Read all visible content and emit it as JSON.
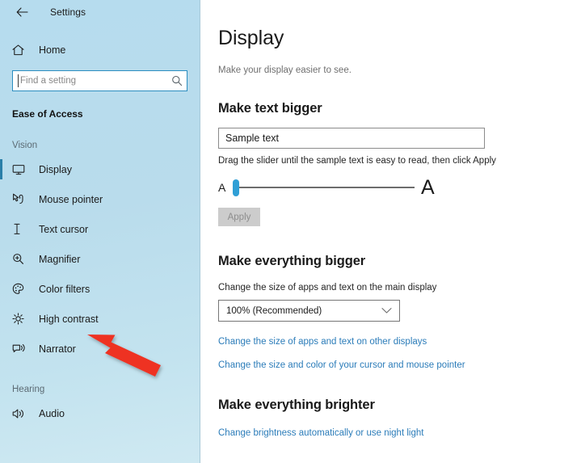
{
  "window": {
    "back_label": "Back",
    "title": "Settings"
  },
  "sidebar": {
    "home": {
      "label": "Home",
      "icon": "home-icon"
    },
    "search": {
      "value": "",
      "placeholder": "Find a setting",
      "icon": "search-icon"
    },
    "category": "Ease of Access",
    "groups": [
      {
        "heading": "Vision",
        "items": [
          {
            "label": "Display",
            "icon": "monitor-icon",
            "selected": true
          },
          {
            "label": "Mouse pointer",
            "icon": "mouse-pointer-icon",
            "selected": false
          },
          {
            "label": "Text cursor",
            "icon": "text-cursor-icon",
            "selected": false
          },
          {
            "label": "Magnifier",
            "icon": "magnifier-icon",
            "selected": false
          },
          {
            "label": "Color filters",
            "icon": "palette-icon",
            "selected": false
          },
          {
            "label": "High contrast",
            "icon": "sun-icon",
            "selected": false
          },
          {
            "label": "Narrator",
            "icon": "narrator-icon",
            "selected": false
          }
        ]
      },
      {
        "heading": "Hearing",
        "items": [
          {
            "label": "Audio",
            "icon": "speaker-icon",
            "selected": false
          }
        ]
      }
    ]
  },
  "main": {
    "title": "Display",
    "subtitle": "Make your display easier to see.",
    "make_text_bigger": {
      "heading": "Make text bigger",
      "sample_text": "Sample text",
      "hint": "Drag the slider until the sample text is easy to read, then click Apply",
      "slider": {
        "min_label": "A",
        "max_label": "A",
        "value": 0,
        "min": 0,
        "max": 100
      },
      "apply_label": "Apply"
    },
    "make_everything_bigger": {
      "heading": "Make everything bigger",
      "scale_label": "Change the size of apps and text on the main display",
      "scale_value": "100% (Recommended)",
      "chevron_icon": "chevron-down-icon",
      "links": [
        "Change the size of apps and text on other displays",
        "Change the size and color of your cursor and mouse pointer"
      ]
    },
    "make_everything_brighter": {
      "heading": "Make everything brighter",
      "links": [
        "Change brightness automatically or use night light"
      ]
    }
  },
  "annotation": {
    "arrow": {
      "color": "#ee3124",
      "points_to": "High contrast"
    }
  },
  "colors": {
    "sidebar_top": "#b6dcee",
    "sidebar_bottom": "#cfe9f2",
    "accent": "#2a7fa8",
    "link": "#2b7cb9",
    "slider_thumb": "#2f9fd6",
    "arrow_red": "#ee3124"
  }
}
